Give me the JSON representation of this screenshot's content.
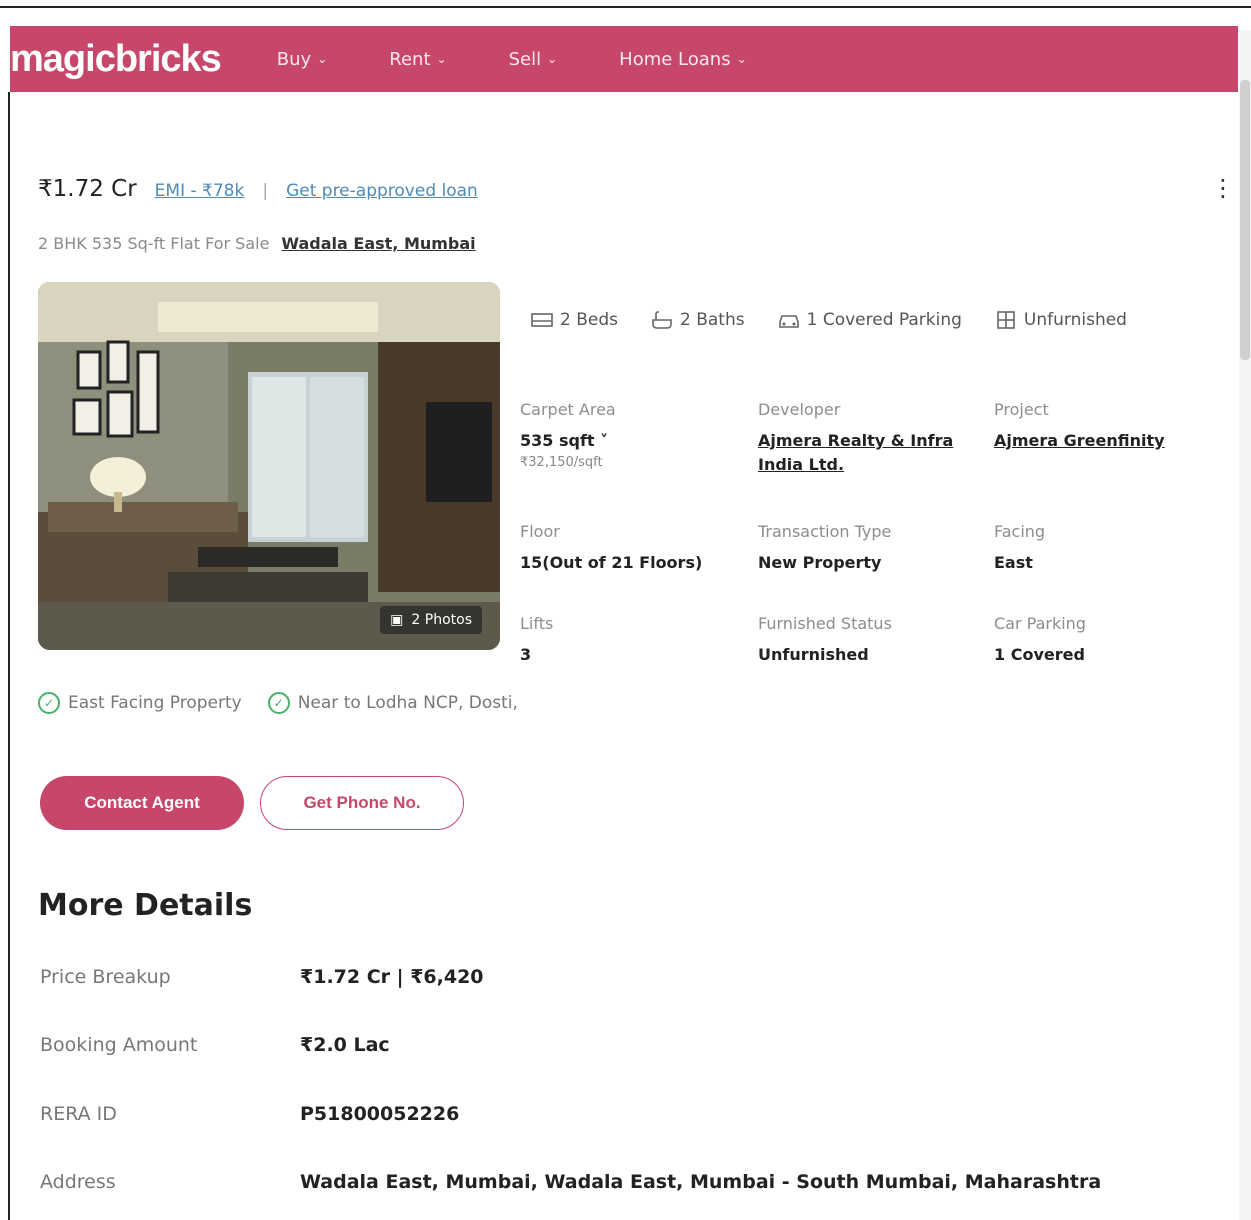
{
  "header": {
    "logo": "magicbricks",
    "nav": [
      {
        "label": "Buy"
      },
      {
        "label": "Rent"
      },
      {
        "label": "Sell"
      },
      {
        "label": "Home Loans"
      }
    ]
  },
  "listing": {
    "price": "₹1.72 Cr",
    "emi": "EMI - ₹78k",
    "separator": "|",
    "loan_link": "Get pre-approved loan",
    "subtitle": "2 BHK 535 Sq-ft Flat For Sale",
    "location": "Wadala East, Mumbai",
    "photo_count": "2 Photos"
  },
  "amenities": [
    {
      "icon": "bed-icon",
      "label": "2 Beds"
    },
    {
      "icon": "bath-icon",
      "label": "2 Baths"
    },
    {
      "icon": "car-icon",
      "label": "1 Covered Parking"
    },
    {
      "icon": "furnish-icon",
      "label": "Unfurnished"
    }
  ],
  "details": {
    "carpet_area": {
      "label": "Carpet Area",
      "value": "535 sqft ˅",
      "sub": "₹32,150/sqft"
    },
    "developer": {
      "label": "Developer",
      "value": "Ajmera Realty & Infra India Ltd."
    },
    "project": {
      "label": "Project",
      "value": "Ajmera Greenfinity"
    },
    "floor": {
      "label": "Floor",
      "value": "15(Out of 21 Floors)"
    },
    "transaction": {
      "label": "Transaction Type",
      "value": "New Property"
    },
    "facing": {
      "label": "Facing",
      "value": "East"
    },
    "lifts": {
      "label": "Lifts",
      "value": "3"
    },
    "furnished": {
      "label": "Furnished Status",
      "value": "Unfurnished"
    },
    "car_parking": {
      "label": "Car Parking",
      "value": "1 Covered"
    }
  },
  "highlights": [
    {
      "label": "East Facing Property"
    },
    {
      "label": "Near to Lodha NCP, Dosti,"
    }
  ],
  "actions": {
    "contact": "Contact Agent",
    "phone": "Get Phone No."
  },
  "more_details": {
    "title": "More Details",
    "rows": [
      {
        "label": "Price Breakup",
        "value": "₹1.72 Cr | ₹6,420"
      },
      {
        "label": "Booking Amount",
        "value": "₹2.0 Lac"
      },
      {
        "label": "RERA ID",
        "value": "P51800052226"
      },
      {
        "label": "Address",
        "value": "Wadala East, Mumbai, Wadala East, Mumbai - South Mumbai, Maharashtra"
      }
    ]
  },
  "colors": {
    "brand": "#c7476a",
    "link": "#4f8ab8",
    "check": "#4bb06a"
  }
}
